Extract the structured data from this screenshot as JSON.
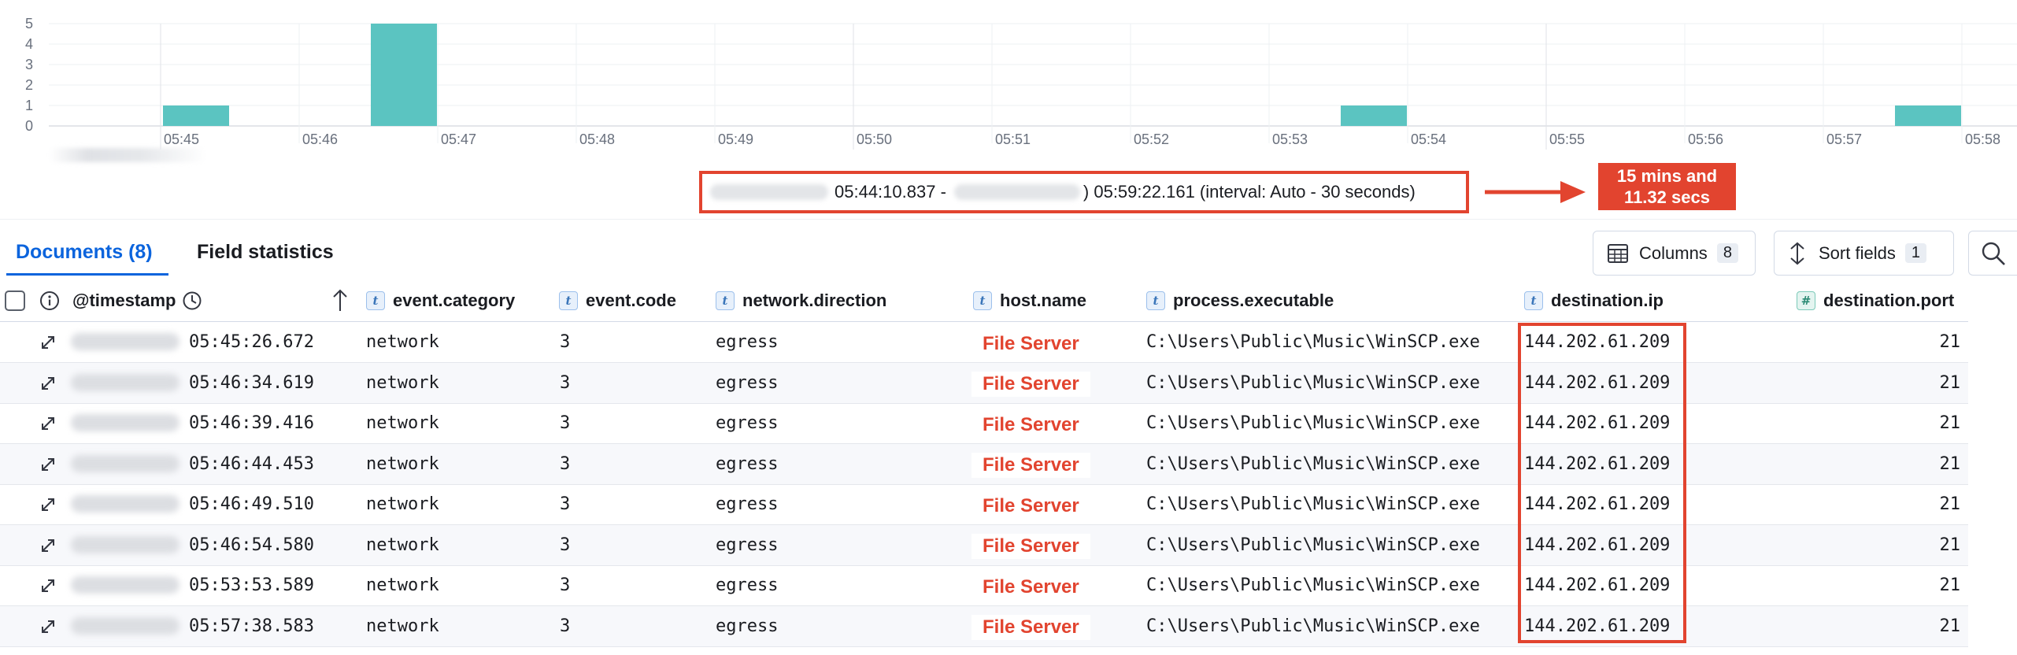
{
  "histogram": {
    "y_ticks": [
      "5",
      "4",
      "3",
      "2",
      "1",
      "0"
    ],
    "x_ticks": [
      "05:45",
      "05:46",
      "05:47",
      "05:48",
      "05:49",
      "05:50",
      "05:51",
      "05:52",
      "05:53",
      "05:54",
      "05:55",
      "05:56",
      "05:57",
      "05:58"
    ],
    "bar_color": "#5bc4c1",
    "bars": [
      {
        "label": "05:45:00",
        "count": 1
      },
      {
        "label": "05:46:30",
        "count": 5
      },
      {
        "label": "05:53:30",
        "count": 1
      },
      {
        "label": "05:57:30",
        "count": 1
      }
    ]
  },
  "time_range": {
    "start": "05:44:10.837 -",
    "end": ") 05:59:22.161 (interval: Auto - 30 seconds)"
  },
  "annotation": {
    "line1": "15 mins and",
    "line2": "11.32 secs",
    "color": "#e2442f"
  },
  "tabs": {
    "documents": "Documents (8)",
    "field_statistics": "Field statistics"
  },
  "toolbar": {
    "columns_label": "Columns",
    "columns_count": "8",
    "sort_label": "Sort fields",
    "sort_count": "1"
  },
  "table": {
    "timestamp_header": "@timestamp",
    "columns": [
      {
        "name": "event.category",
        "type": "t"
      },
      {
        "name": "event.code",
        "type": "t"
      },
      {
        "name": "network.direction",
        "type": "t"
      },
      {
        "name": "host.name",
        "type": "t"
      },
      {
        "name": "process.executable",
        "type": "t"
      },
      {
        "name": "destination.ip",
        "type": "t"
      },
      {
        "name": "destination.port",
        "type": "#"
      }
    ],
    "rows": [
      {
        "time": "05:45:26.672",
        "category": "network",
        "code": "3",
        "direction": "egress",
        "host": "File Server",
        "executable": "C:\\Users\\Public\\Music\\WinSCP.exe",
        "ip": "144.202.61.209",
        "port": "21"
      },
      {
        "time": "05:46:34.619",
        "category": "network",
        "code": "3",
        "direction": "egress",
        "host": "File Server",
        "executable": "C:\\Users\\Public\\Music\\WinSCP.exe",
        "ip": "144.202.61.209",
        "port": "21"
      },
      {
        "time": "05:46:39.416",
        "category": "network",
        "code": "3",
        "direction": "egress",
        "host": "File Server",
        "executable": "C:\\Users\\Public\\Music\\WinSCP.exe",
        "ip": "144.202.61.209",
        "port": "21"
      },
      {
        "time": "05:46:44.453",
        "category": "network",
        "code": "3",
        "direction": "egress",
        "host": "File Server",
        "executable": "C:\\Users\\Public\\Music\\WinSCP.exe",
        "ip": "144.202.61.209",
        "port": "21"
      },
      {
        "time": "05:46:49.510",
        "category": "network",
        "code": "3",
        "direction": "egress",
        "host": "File Server",
        "executable": "C:\\Users\\Public\\Music\\WinSCP.exe",
        "ip": "144.202.61.209",
        "port": "21"
      },
      {
        "time": "05:46:54.580",
        "category": "network",
        "code": "3",
        "direction": "egress",
        "host": "File Server",
        "executable": "C:\\Users\\Public\\Music\\WinSCP.exe",
        "ip": "144.202.61.209",
        "port": "21"
      },
      {
        "time": "05:53:53.589",
        "category": "network",
        "code": "3",
        "direction": "egress",
        "host": "File Server",
        "executable": "C:\\Users\\Public\\Music\\WinSCP.exe",
        "ip": "144.202.61.209",
        "port": "21"
      },
      {
        "time": "05:57:38.583",
        "category": "network",
        "code": "3",
        "direction": "egress",
        "host": "File Server",
        "executable": "C:\\Users\\Public\\Music\\WinSCP.exe",
        "ip": "144.202.61.209",
        "port": "21"
      }
    ]
  }
}
